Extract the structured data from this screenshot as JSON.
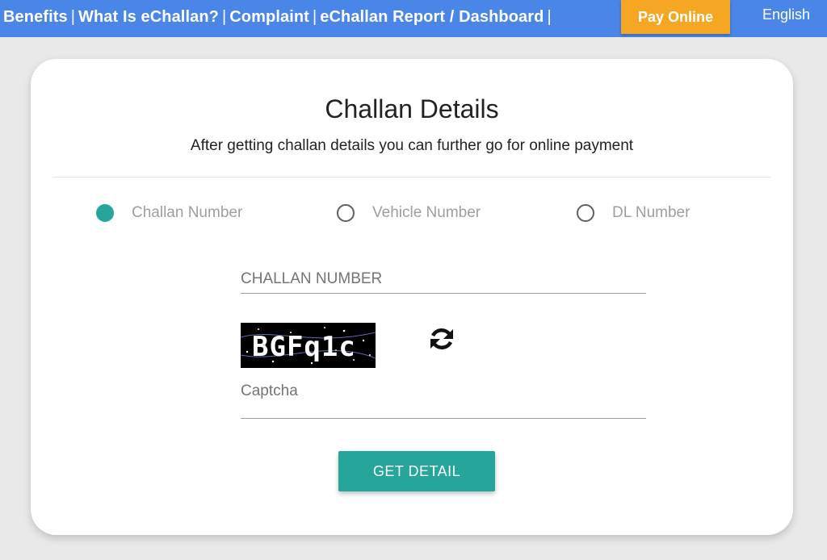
{
  "nav": {
    "links": [
      "Benefits",
      "What Is eChallan?",
      "Complaint",
      "eChallan Report / Dashboard"
    ],
    "separator": "|",
    "pay_online": "Pay Online",
    "language": "English"
  },
  "card": {
    "title": "Challan Details",
    "subtitle": "After getting challan details you can further go for online payment",
    "radio_options": [
      {
        "label": "Challan Number",
        "selected": true
      },
      {
        "label": "Vehicle Number",
        "selected": false
      },
      {
        "label": "DL Number",
        "selected": false
      }
    ],
    "challan_field_placeholder": "CHALLAN NUMBER",
    "captcha_text": "BGFq1c",
    "captcha_field_placeholder": "Captcha",
    "submit_label": "GET DETAIL"
  },
  "colors": {
    "topbar": "#4a86e8",
    "pay_button": "#f5a623",
    "accent": "#26a69a"
  },
  "icons": {
    "refresh": "refresh-icon"
  }
}
